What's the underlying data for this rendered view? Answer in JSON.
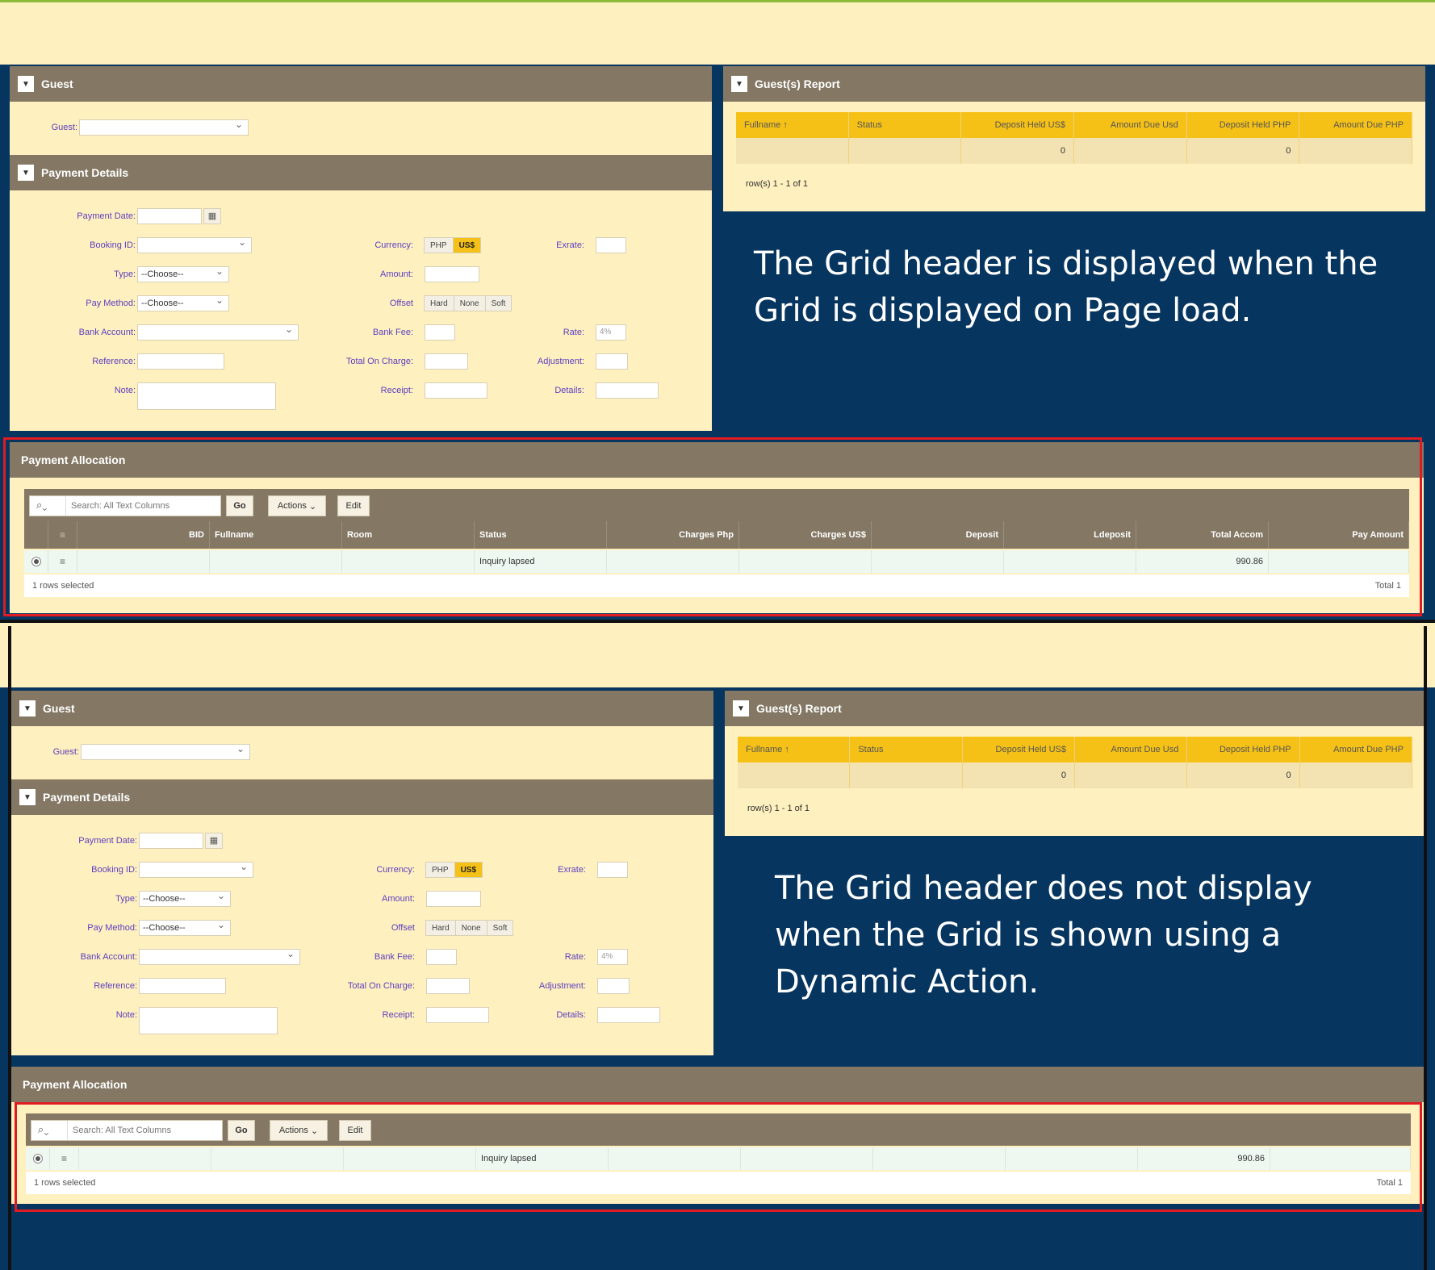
{
  "guest_region": {
    "title": "Guest",
    "guest_label": "Guest:"
  },
  "payment_details": {
    "title": "Payment Details",
    "payment_date_label": "Payment Date:",
    "booking_id_label": "Booking ID:",
    "type_label": "Type:",
    "type_value": "--Choose--",
    "pay_method_label": "Pay Method:",
    "pay_method_value": "--Choose--",
    "bank_account_label": "Bank Account:",
    "reference_label": "Reference:",
    "note_label": "Note:",
    "currency_label": "Currency:",
    "currency_options": [
      "PHP",
      "US$"
    ],
    "currency_selected": "US$",
    "amount_label": "Amount:",
    "offset_label": "Offset",
    "offset_options": [
      "Hard",
      "None",
      "Soft"
    ],
    "bank_fee_label": "Bank Fee:",
    "total_on_charge_label": "Total On Charge:",
    "receipt_label": "Receipt:",
    "exrate_label": "Exrate:",
    "rate_label": "Rate:",
    "rate_placeholder": "4%",
    "adjustment_label": "Adjustment:",
    "details_label": "Details:"
  },
  "guest_report": {
    "title": "Guest(s) Report",
    "columns": [
      "Fullname",
      "Status",
      "Deposit Held US$",
      "Amount Due Usd",
      "Deposit Held PHP",
      "Amount Due PHP"
    ],
    "sort_indicator": "↑",
    "row": [
      "",
      "",
      "0",
      "",
      "0",
      ""
    ],
    "pagination": "row(s) 1 - 1 of 1"
  },
  "payment_allocation": {
    "title": "Payment Allocation",
    "search_placeholder": "Search: All Text Columns",
    "go_label": "Go",
    "actions_label": "Actions",
    "edit_label": "Edit",
    "columns": [
      "BID",
      "Fullname",
      "Room",
      "Status",
      "Charges Php",
      "Charges US$",
      "Deposit",
      "Ldeposit",
      "Total Accom",
      "Pay Amount"
    ],
    "row": [
      "",
      "",
      "",
      "Inquiry lapsed",
      "",
      "",
      "",
      "",
      "990.86",
      ""
    ],
    "selected_text": "1 rows selected",
    "total_text": "Total 1"
  },
  "annotations": {
    "top": "The Grid header is displayed when the Grid is displayed on Page load.",
    "bottom": "The Grid header does not display when the Grid is shown using a Dynamic Action."
  },
  "colors": {
    "region_bg": "#fff0bf",
    "header_bg": "#847865",
    "navy": "#06355f",
    "accent_yellow": "#f5c117",
    "highlight_red": "#e01b22"
  }
}
